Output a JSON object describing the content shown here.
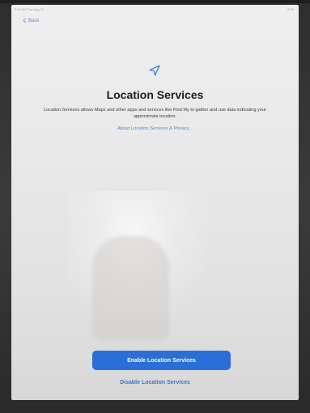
{
  "status_bar": {
    "time_date": "9:41 AM  Tue Aug 13",
    "battery": "97%"
  },
  "header": {
    "back_label": "Back"
  },
  "main": {
    "icon": "location-arrow-icon",
    "title": "Location Services",
    "description": "Location Services allows Maps and other apps and services like Find My to gather and use data indicating your approximate location.",
    "about_link": "About Location Services & Privacy..."
  },
  "actions": {
    "enable_label": "Enable Location Services",
    "disable_label": "Disable Location Services"
  },
  "colors": {
    "accent": "#2a6ed8",
    "link": "#4f86d4"
  }
}
